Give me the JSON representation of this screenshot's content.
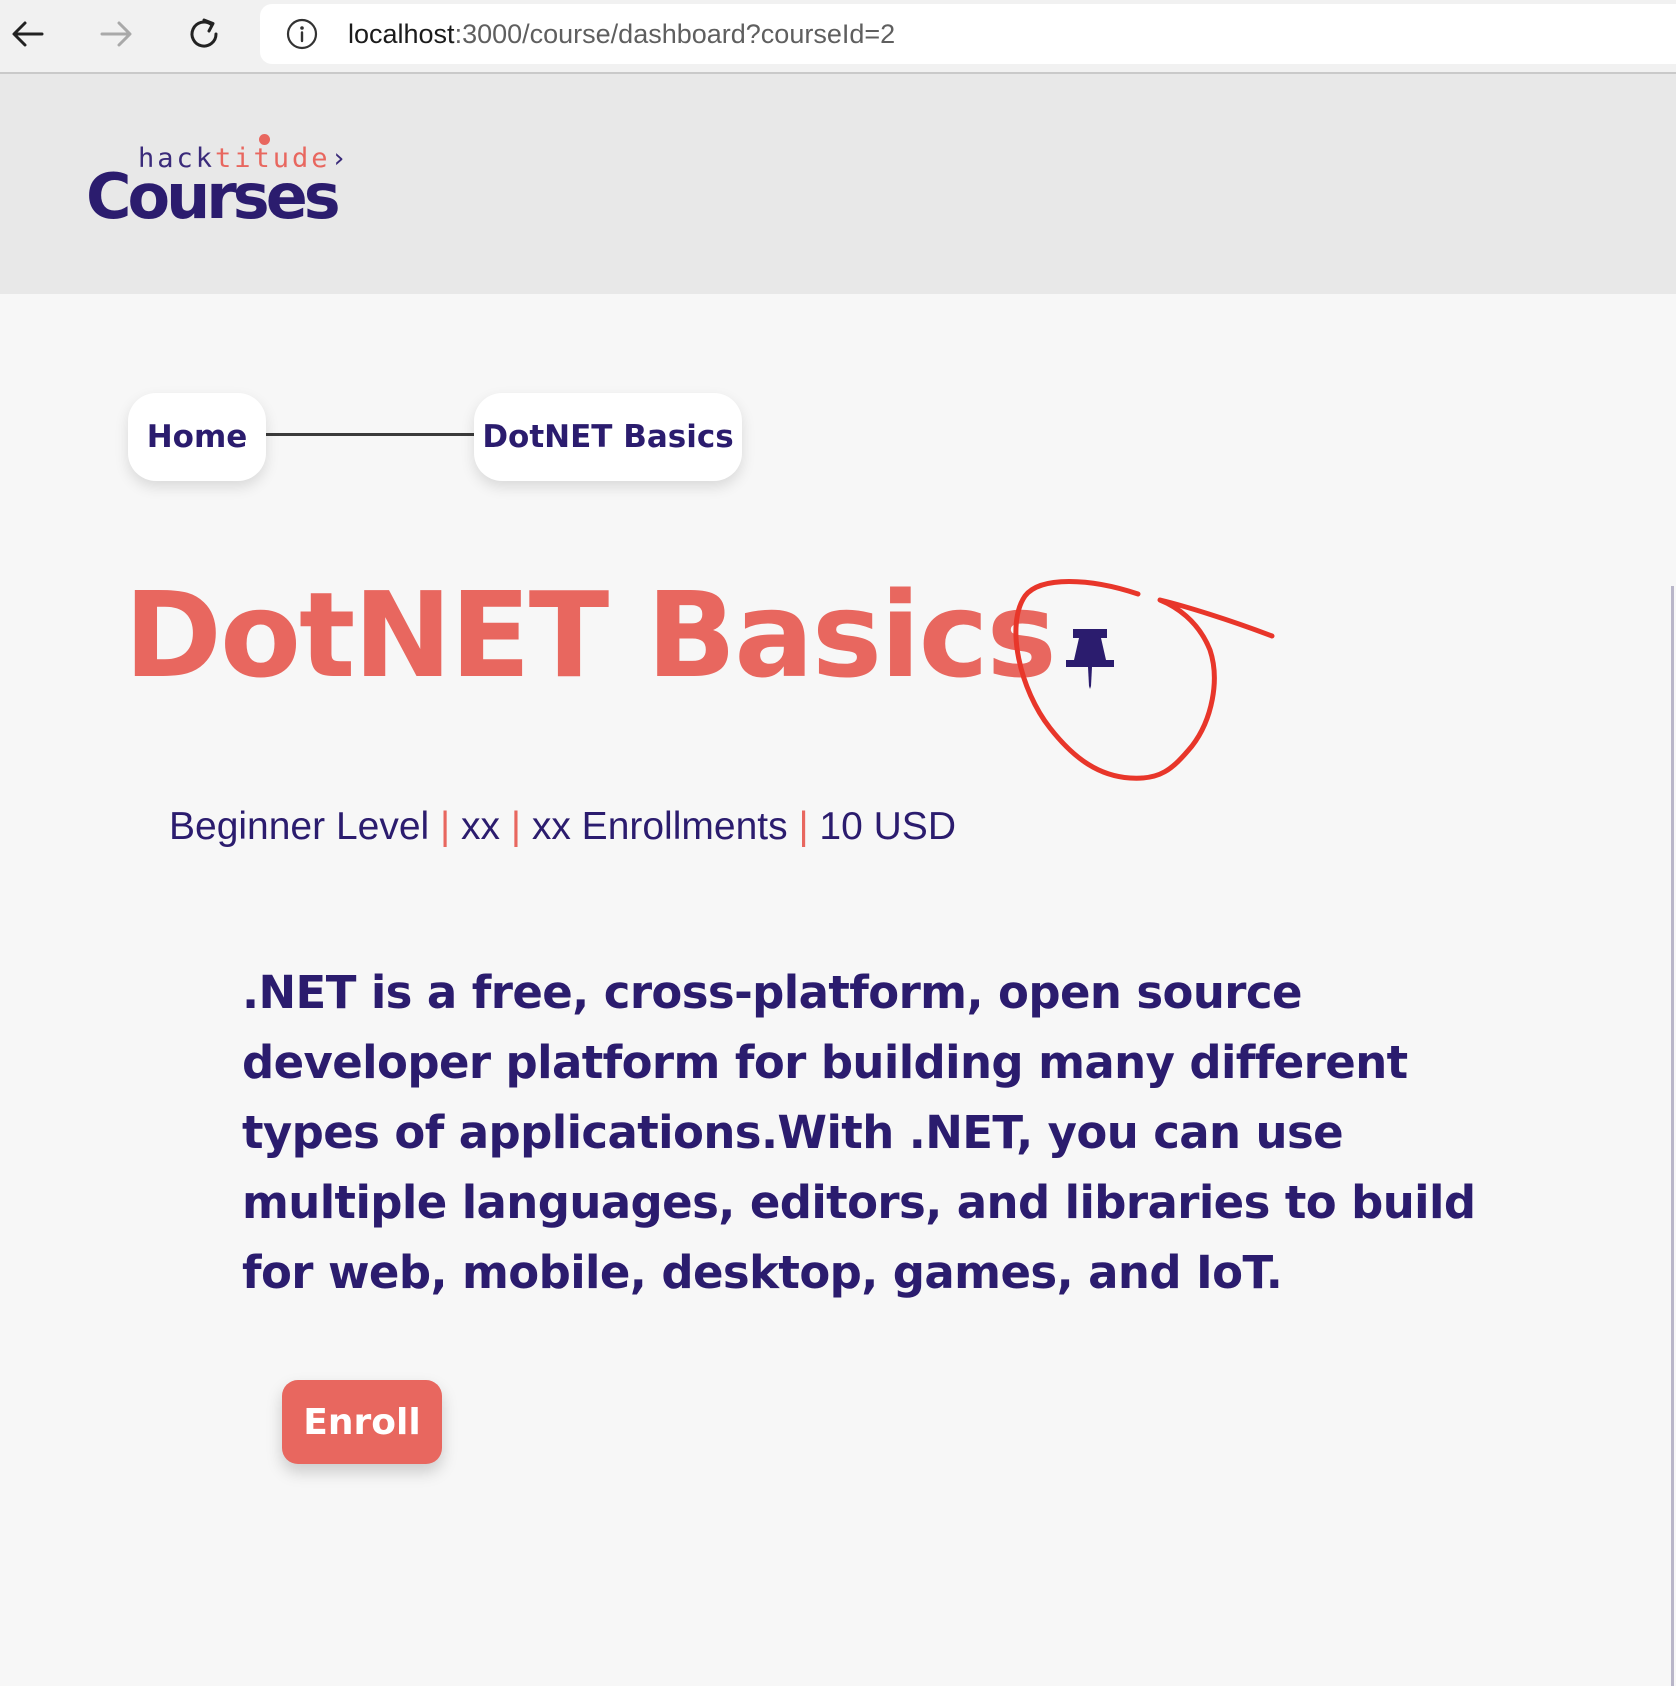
{
  "browser": {
    "url_host": "localhost",
    "url_path": ":3000/course/dashboard?courseId=2"
  },
  "logo": {
    "hack": "hack",
    "titude": "titude",
    "bracket": "›",
    "courses": "Courses"
  },
  "breadcrumb": {
    "home_label": "Home",
    "current_label": "DotNET Basics"
  },
  "course": {
    "title": "DotNET Basics",
    "level": "Beginner Level",
    "meta_2": "xx",
    "enrollments": "xx Enrollments",
    "price": "10 USD",
    "separator": "|",
    "description": ".NET is a free, cross-platform, open source developer platform for building many different types of applications.With .NET, you can use multiple languages, editors, and libraries to build for web, mobile, desktop, games, and IoT.",
    "enroll_label": "Enroll"
  },
  "icons": {
    "back": "back-arrow-icon",
    "forward": "forward-arrow-icon",
    "reload": "reload-icon",
    "info": "info-icon",
    "pin": "pin-icon"
  },
  "colors": {
    "brand_navy": "#2b1c6e",
    "accent_coral": "#e8675f",
    "annotation_red": "#e8362a"
  }
}
